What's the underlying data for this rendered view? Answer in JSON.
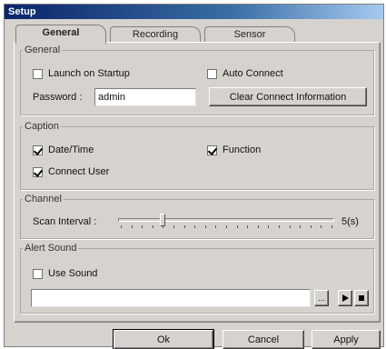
{
  "window": {
    "title": "Setup"
  },
  "tabs": [
    {
      "label": "General",
      "active": true
    },
    {
      "label": "Recording",
      "active": false
    },
    {
      "label": "Sensor",
      "active": false
    }
  ],
  "general_group": {
    "legend": "General",
    "launch_on_startup": {
      "label": "Launch on Startup",
      "checked": false
    },
    "auto_connect": {
      "label": "Auto Connect",
      "checked": false
    },
    "password_label": "Password :",
    "password_value": "admin",
    "clear_button": "Clear Connect Information"
  },
  "caption_group": {
    "legend": "Caption",
    "date_time": {
      "label": "Date/Time",
      "checked": true
    },
    "function": {
      "label": "Function",
      "checked": true
    },
    "connect_user": {
      "label": "Connect User",
      "checked": true
    }
  },
  "channel_group": {
    "legend": "Channel",
    "scan_interval_label": "Scan Interval :",
    "scan_interval_value": "5(s)",
    "slider_fraction": 0.2
  },
  "alert_group": {
    "legend": "Alert Sound",
    "use_sound": {
      "label": "Use Sound",
      "checked": false
    },
    "sound_path": "",
    "browse_label": "...",
    "play_icon": "play-icon",
    "stop_icon": "stop-icon"
  },
  "footer": {
    "ok": "Ok",
    "cancel": "Cancel",
    "apply": "Apply"
  }
}
